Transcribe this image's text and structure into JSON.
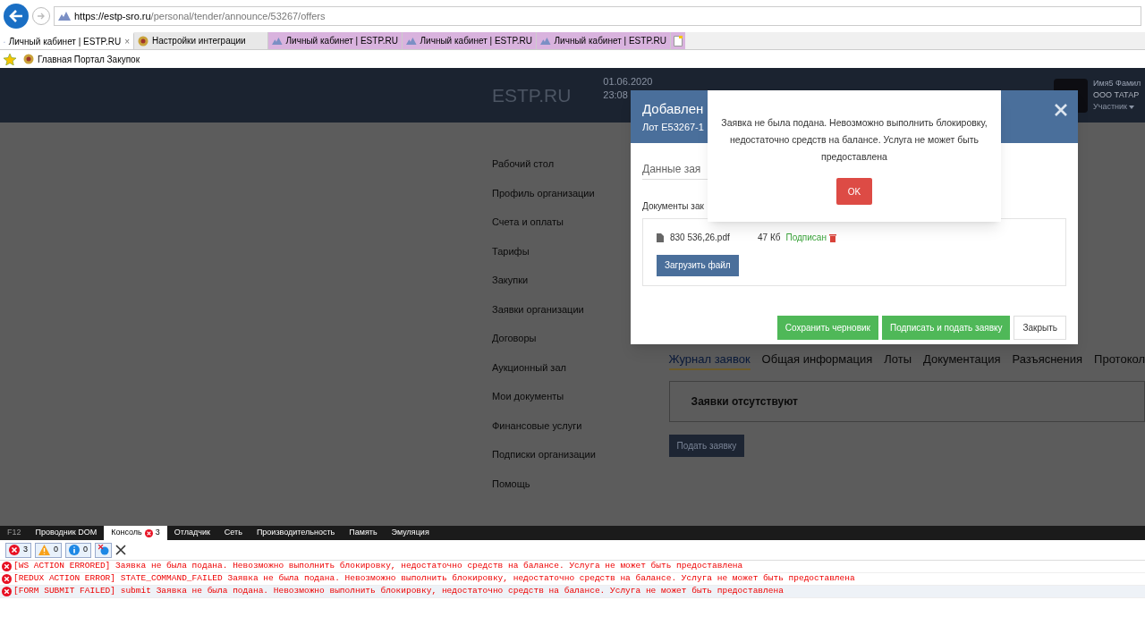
{
  "browser": {
    "address": {
      "host": "https://estp-sro.ru",
      "path": "/personal/tender/announce/53267/offers"
    },
    "tabs": [
      {
        "label": "Личный кабинет | ESTP.RU",
        "kind": "site",
        "selected": true,
        "color": "#ffffff",
        "close": "×"
      },
      {
        "label": "Настройки интеграции",
        "kind": "emblem",
        "selected": false,
        "color": "#e8e8e8"
      },
      {
        "label": "Личный кабинет | ESTP.RU",
        "kind": "site",
        "selected": false,
        "color": "#d9b3de"
      },
      {
        "label": "Личный кабинет | ESTP.RU",
        "kind": "site",
        "selected": false,
        "color": "#d9b3de"
      },
      {
        "label": "Личный кабинет | ESTP.RU",
        "kind": "site",
        "selected": false,
        "color": "#d9b3de"
      }
    ],
    "favorites": [
      {
        "label": "Главная Портал Закупок"
      }
    ]
  },
  "site": {
    "logo": "ESTP.RU",
    "date": "01.06.2020",
    "time": "23:08",
    "user": {
      "name": "Имя5 Фамил",
      "org": "ООО ТАТАР",
      "role": "Участник"
    },
    "sidebar": [
      {
        "label": "Рабочий стол"
      },
      {
        "label": "Профиль организации"
      },
      {
        "label": "Счета и оплаты"
      },
      {
        "label": "Тарифы"
      },
      {
        "label": "Закупки"
      },
      {
        "label": "Заявки организации"
      },
      {
        "label": "Договоры"
      },
      {
        "label": "Аукционный зал"
      },
      {
        "label": "Мои документы"
      },
      {
        "label": "Финансовые услуги"
      },
      {
        "label": "Подписки организации"
      },
      {
        "label": "Помощь"
      }
    ],
    "tabs": [
      {
        "label": "Журнал заявок",
        "selected": true
      },
      {
        "label": "Общая информация",
        "selected": false
      },
      {
        "label": "Лоты",
        "selected": false
      },
      {
        "label": "Документация",
        "selected": false
      },
      {
        "label": "Разъяснения",
        "selected": false
      },
      {
        "label": "Протокол",
        "selected": false
      }
    ],
    "empty_message": "Заявки отсутствуют",
    "submit_button": "Подать заявку"
  },
  "modal": {
    "title": "Добавлен",
    "subtitle": "Лот E53267-1",
    "section": "Данные зая",
    "docs_label": "Документы зак",
    "file": {
      "name": "830 536,26.pdf",
      "size": "47 Кб",
      "status": "Подписан"
    },
    "upload_button": "Загрузить файл",
    "buttons": [
      {
        "label": "Сохранить черновик",
        "kind": "primary"
      },
      {
        "label": "Подписать и подать заявку",
        "kind": "primary"
      },
      {
        "label": "Закрыть",
        "kind": "default"
      }
    ]
  },
  "alert": {
    "message": "Заявка не была подана. Невозможно выполнить блокировку, недостаточно средств на балансе. Услуга не может быть предоставлена",
    "ok_button": "OK"
  },
  "devtools": {
    "tabs": [
      {
        "label": "F12",
        "selected": false
      },
      {
        "label": "Проводник DOM",
        "selected": false
      },
      {
        "label": "Консоль",
        "selected": true,
        "badge": "3"
      },
      {
        "label": "Отладчик",
        "selected": false
      },
      {
        "label": "Сеть",
        "selected": false
      },
      {
        "label": "Производительность",
        "selected": false
      },
      {
        "label": "Память",
        "selected": false
      },
      {
        "label": "Эмуляция",
        "selected": false
      }
    ],
    "filters": [
      {
        "kind": "error",
        "count": "3"
      },
      {
        "kind": "warning",
        "count": "0"
      },
      {
        "kind": "info",
        "count": "0"
      }
    ],
    "messages": [
      {
        "text": "[WS ACTION ERRORED] Заявка не была подана. Невозможно выполнить блокировку, недостаточно средств на балансе. Услуга не может быть предоставлена",
        "selected": false
      },
      {
        "text": "[REDUX ACTION ERROR] STATE_COMMAND_FAILED Заявка не была подана. Невозможно выполнить блокировку, недостаточно средств на балансе. Услуга не может быть предоставлена",
        "selected": false
      },
      {
        "text": "[FORM SUBMIT FAILED] submit Заявка не была подана. Невозможно выполнить блокировку, недостаточно средств на балансе. Услуга не может быть предоставлена",
        "selected": true
      }
    ]
  }
}
